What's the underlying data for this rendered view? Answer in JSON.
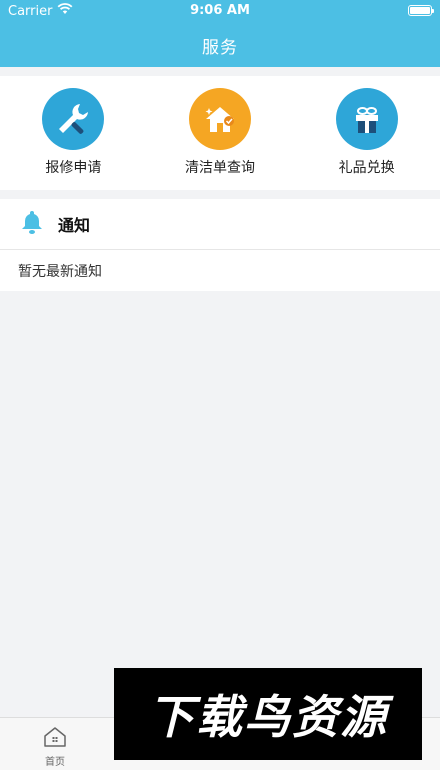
{
  "status_bar": {
    "carrier": "Carrier",
    "time": "9:06 AM",
    "wifi_icon": "wifi-icon",
    "battery_icon": "battery-icon"
  },
  "header": {
    "title": "服务",
    "color": "#4cbfe4"
  },
  "services": [
    {
      "label": "报修申请",
      "icon": "wrench-icon",
      "color": "#2ea6d8"
    },
    {
      "label": "清洁单查询",
      "icon": "clean-house-icon",
      "color": "#f5a623"
    },
    {
      "label": "礼品兑换",
      "icon": "gift-icon",
      "color": "#2ea6d8"
    }
  ],
  "notice": {
    "icon": "bell-icon",
    "title": "通知",
    "empty_text": "暂无最新通知"
  },
  "tabbar": {
    "tabs": [
      {
        "label": "首页",
        "icon": "home-icon"
      },
      {
        "label": "",
        "icon": ""
      },
      {
        "label": "",
        "icon": ""
      },
      {
        "label": "",
        "icon": ""
      }
    ]
  },
  "watermark": {
    "text": "下载鸟资源"
  }
}
